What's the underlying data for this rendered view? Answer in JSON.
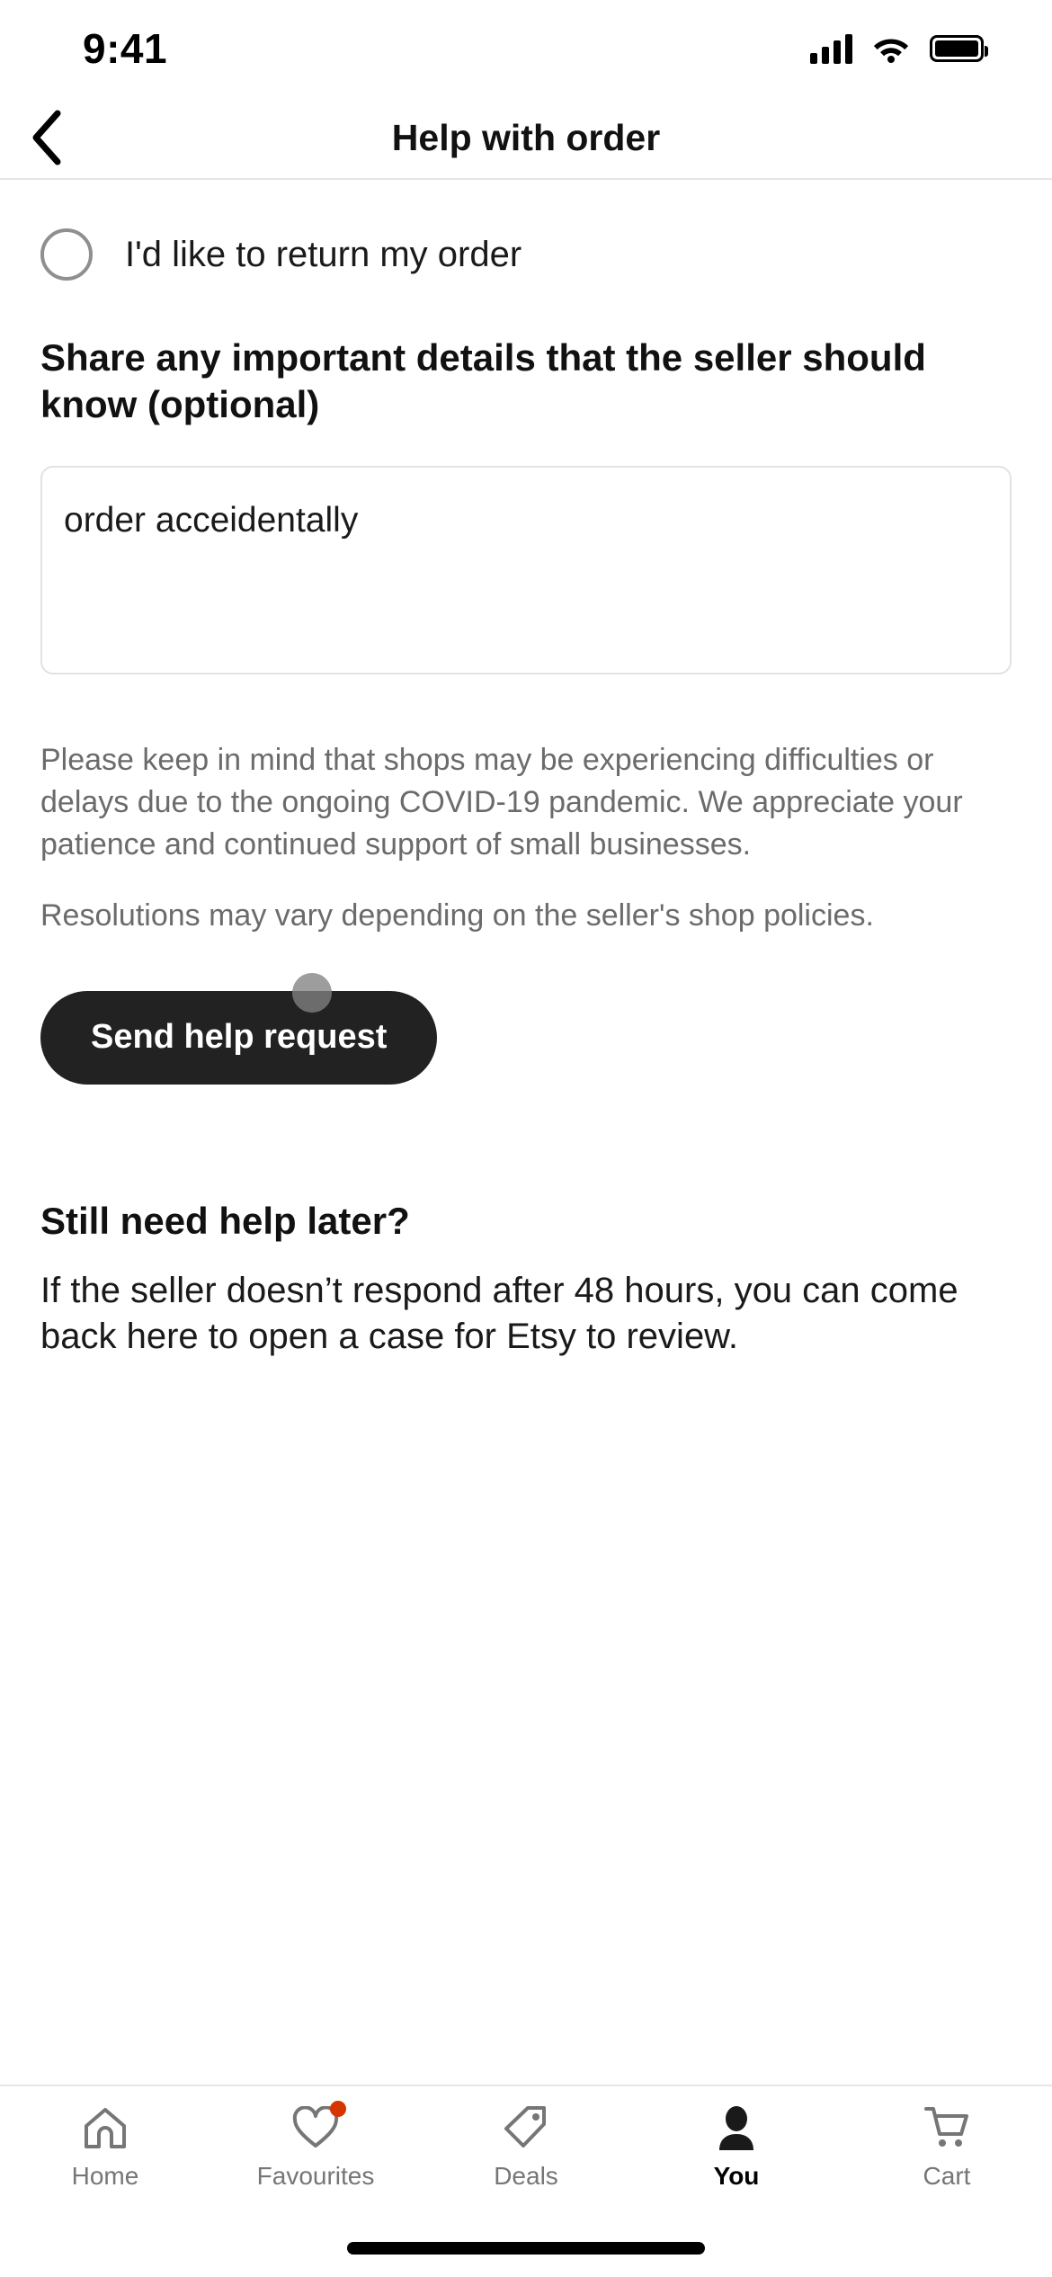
{
  "status_bar": {
    "time": "9:41",
    "cellular_icon": "signal-bars-icon",
    "wifi_icon": "wifi-icon",
    "battery_icon": "battery-full-icon"
  },
  "header": {
    "back_icon": "back-chevron-icon",
    "title": "Help with order"
  },
  "form": {
    "radio_option": {
      "label": "I'd like to return my order",
      "selected": false
    },
    "details_heading": "Share any important details that the seller should know (optional)",
    "details_textarea": {
      "value": "order acceidentally",
      "placeholder": ""
    },
    "disclaimers": [
      "Please keep in mind that shops may be experiencing difficulties or delays due to the ongoing COVID-19 pandemic. We appreciate your patience and continued support of small businesses.",
      "Resolutions may vary depending on the seller's shop policies."
    ],
    "submit_label": "Send help request"
  },
  "later_section": {
    "heading": "Still need help later?",
    "body": "If the seller doesn’t respond after 48 hours, you can come back here to open a case for Etsy to review."
  },
  "tab_bar": {
    "items": [
      {
        "label": "Home",
        "icon": "home-icon",
        "active": false,
        "badge": false
      },
      {
        "label": "Favourites",
        "icon": "heart-icon",
        "active": false,
        "badge": true
      },
      {
        "label": "Deals",
        "icon": "tag-icon",
        "active": false,
        "badge": false
      },
      {
        "label": "You",
        "icon": "person-icon",
        "active": true,
        "badge": false
      },
      {
        "label": "Cart",
        "icon": "cart-icon",
        "active": false,
        "badge": false
      }
    ]
  },
  "colors": {
    "accent_dark": "#222222",
    "badge_red": "#d63500",
    "muted_text": "#6b6b6b",
    "border": "#e6e6e6"
  }
}
